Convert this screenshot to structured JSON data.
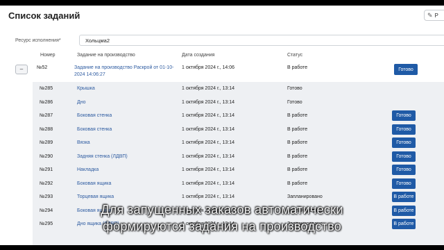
{
  "page": {
    "title": "Список заданий",
    "top_button_label": "Р"
  },
  "resource": {
    "label": "Ресурс исполнения*",
    "value": "Хольцма2"
  },
  "columns": {
    "number": "Номер",
    "task": "Задание на производство",
    "created": "Дата создания",
    "status": "Статус"
  },
  "main_row": {
    "toggle": "–",
    "number": "№52",
    "task": "Задание на производство Раскрой от 01-10-2024 14:06:27",
    "created": "1 октября 2024 г., 14:06",
    "status": "В работе",
    "button": "Готово"
  },
  "rows": [
    {
      "number": "№285",
      "task": "Крышка",
      "created": "1 октября 2024 г., 13:14",
      "status": "Готово",
      "button": ""
    },
    {
      "number": "№286",
      "task": "Дно",
      "created": "1 октября 2024 г., 13:14",
      "status": "Готово",
      "button": ""
    },
    {
      "number": "№287",
      "task": "Боковая стенка",
      "created": "1 октября 2024 г., 13:14",
      "status": "В работе",
      "button": "Готово"
    },
    {
      "number": "№288",
      "task": "Боковая стенка",
      "created": "1 октября 2024 г., 13:14",
      "status": "В работе",
      "button": "Готово"
    },
    {
      "number": "№289",
      "task": "Вязка",
      "created": "1 октября 2024 г., 13:14",
      "status": "В работе",
      "button": "Готово"
    },
    {
      "number": "№290",
      "task": "Задняя стенка (ЛДВП)",
      "created": "1 октября 2024 г., 13:14",
      "status": "В работе",
      "button": "Готово"
    },
    {
      "number": "№291",
      "task": "Накладка",
      "created": "1 октября 2024 г., 13:14",
      "status": "В работе",
      "button": "Готово"
    },
    {
      "number": "№292",
      "task": "Боковая ящика",
      "created": "1 октября 2024 г., 13:14",
      "status": "В работе",
      "button": "Готово"
    },
    {
      "number": "№293",
      "task": "Торцевая ящика",
      "created": "1 октября 2024 г., 13:14",
      "status": "Запланировано",
      "button": "В работе"
    },
    {
      "number": "№294",
      "task": "Боковая ящика",
      "created": "1 октября 2024 г., 13:14",
      "status": "Запланировано",
      "button": "В работе"
    },
    {
      "number": "№295",
      "task": "Дно ящика (ЛДВП)",
      "created": "1 октября 2024 г., 13:14",
      "status": "Запланировано",
      "button": "В работе"
    }
  ],
  "caption": {
    "line1": "Для запущенных заказов автоматически",
    "line2": "формируются задания на производство"
  },
  "colors": {
    "primary_button": "#1f5aa6",
    "link": "#2c5aa0",
    "subtable_bg": "#eef0f3"
  }
}
